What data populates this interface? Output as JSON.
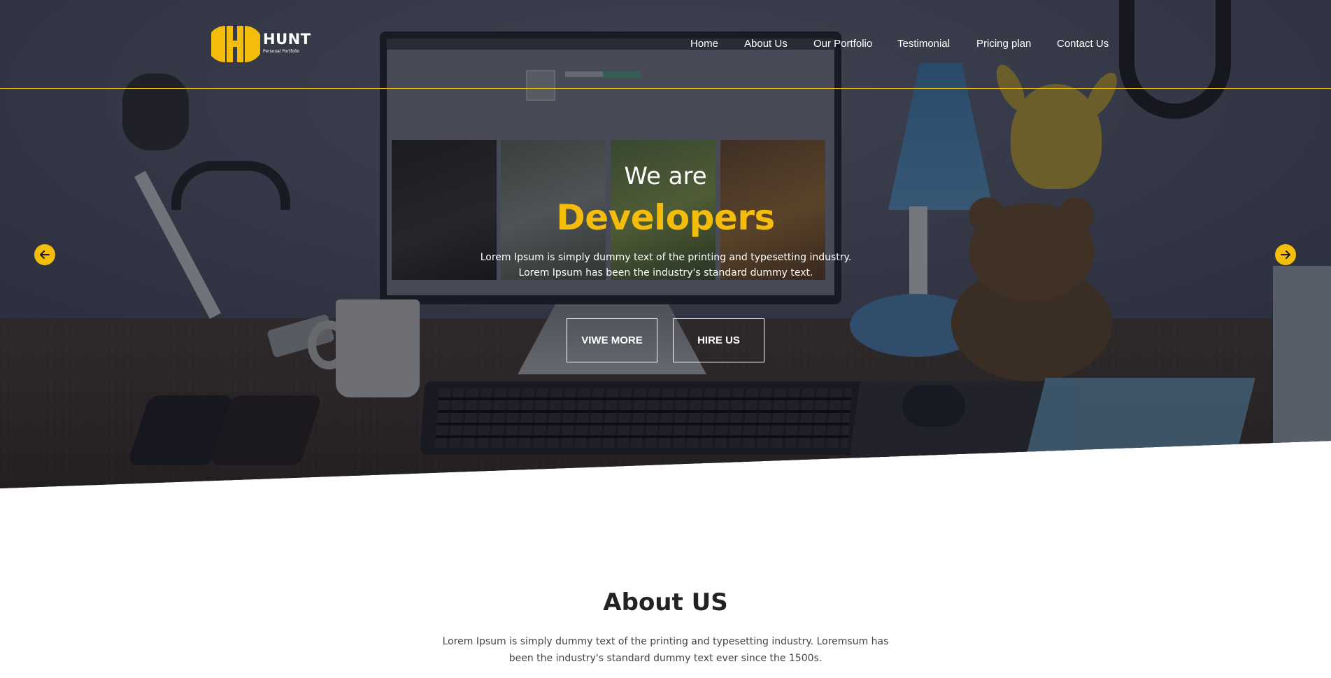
{
  "brand": {
    "name": "HUNT",
    "tagline": "Personal Portfolio",
    "accent_color": "#f5bd0b"
  },
  "nav": {
    "items": [
      {
        "label": "Home"
      },
      {
        "label": "About Us"
      },
      {
        "label": "Our Portfolio"
      },
      {
        "label": "Testimonial"
      },
      {
        "label": "Pricing plan"
      },
      {
        "label": "Contact Us"
      }
    ]
  },
  "hero": {
    "kicker": "We are",
    "headline": "Developers",
    "copy": "Lorem Ipsum is simply dummy text of the printing and typesetting industry. Lorem Ipsum has been the industry's standard dummy text.",
    "buttons": {
      "view_more": "VIWE MORE",
      "hire_us": "HIRE US"
    },
    "prev_icon": "arrow-left-icon",
    "next_icon": "arrow-right-icon"
  },
  "about": {
    "title": "About US",
    "copy": "Lorem Ipsum is simply dummy text of the printing and typesetting industry. Loremsum has been the industry's standard dummy text ever since the 1500s."
  }
}
